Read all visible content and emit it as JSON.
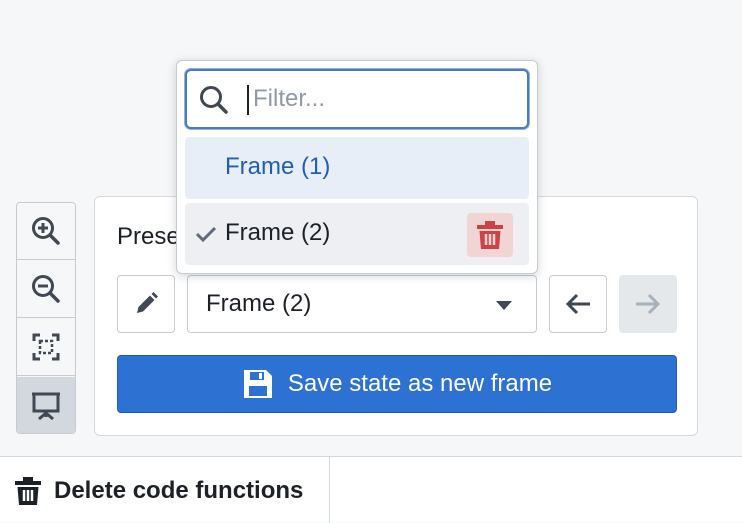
{
  "toolbar": {
    "buttons": [
      {
        "icon": "zoom-in-icon"
      },
      {
        "icon": "zoom-out-icon"
      },
      {
        "icon": "fit-to-screen-icon"
      },
      {
        "icon": "presentation-icon",
        "active": true
      }
    ]
  },
  "panel": {
    "title": "Prese",
    "frame_select": {
      "value": "Frame (2)"
    },
    "save_button_label": "Save state as new frame"
  },
  "dropdown": {
    "filter_placeholder": "Filter...",
    "items": [
      {
        "label": "Frame (1)",
        "selected": false,
        "hovered": true
      },
      {
        "label": "Frame (2)",
        "selected": true,
        "hovered": false
      }
    ]
  },
  "bottom_bar": {
    "delete_code_label": "Delete code functions"
  },
  "colors": {
    "primary": "#2d72d2",
    "danger": "#cd4246",
    "danger_bg": "#f1d4d4",
    "hover_text": "#215db0"
  }
}
